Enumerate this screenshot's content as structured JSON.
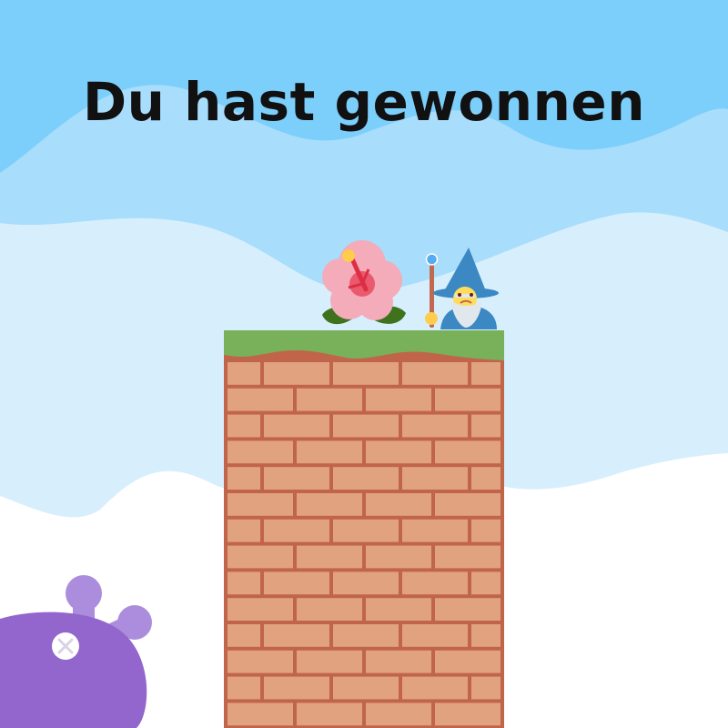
{
  "title": "Du hast gewonnen",
  "colors": {
    "sky_top": "#7ccffb",
    "sky_mid": "#a8ddfc",
    "sky_low": "#d7effd",
    "snow": "#ffffff",
    "brick": "#e1a27f",
    "mortar": "#c1654a",
    "grass": "#78b159",
    "creature": "#9266cc",
    "creature_horn": "#ac8ddd"
  },
  "scene": {
    "tower": "brick-tower",
    "items": [
      {
        "name": "hibiscus-flower-icon",
        "emoji": "🌺"
      },
      {
        "name": "wizard-icon",
        "emoji": "🧙‍♂️"
      }
    ],
    "creature": "purple-creature"
  }
}
